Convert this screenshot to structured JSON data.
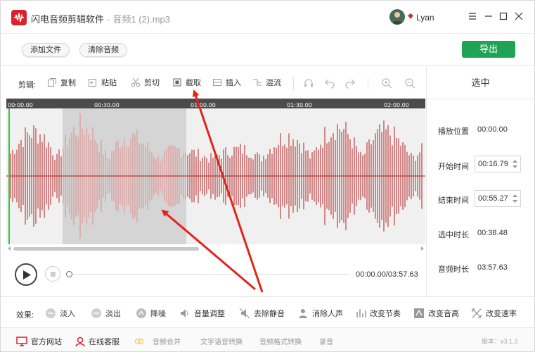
{
  "app": {
    "title": "闪电音频剪辑软件",
    "separator": "-",
    "file_name": "音频1 (2).mp3",
    "user_name": "Lyan",
    "brand_color": "#d9232d",
    "export_color": "#20a357"
  },
  "toolbar": {
    "add_file": "添加文件",
    "clear_audio": "清除音频",
    "export": "导出"
  },
  "edit": {
    "label": "剪辑:",
    "tools": [
      {
        "label": "复制",
        "icon": "copy-icon"
      },
      {
        "label": "粘贴",
        "icon": "paste-icon"
      },
      {
        "label": "剪切",
        "icon": "scissors-icon"
      },
      {
        "label": "截取",
        "icon": "crop-icon"
      },
      {
        "label": "插入",
        "icon": "insert-icon"
      },
      {
        "label": "混流",
        "icon": "mix-icon"
      }
    ]
  },
  "timeline": {
    "ticks": [
      "00:00.00",
      "00:30.00",
      "01:00.00",
      "01:30.00",
      "02:00.00"
    ]
  },
  "panel": {
    "title": "选中",
    "play_position_label": "播放位置",
    "play_position_value": "00:00.00",
    "start_label": "开始时间",
    "start_value": "00:16.79",
    "end_label": "结束时间",
    "end_value": "00:55.27",
    "selected_label": "选中时长",
    "selected_value": "00:38.48",
    "duration_label": "音频时长",
    "duration_value": "03:57.63"
  },
  "transport": {
    "timecode": "00:00.00/03:57.63",
    "progress": 0
  },
  "effects": {
    "label": "效果:",
    "items": [
      {
        "label": "淡入",
        "icon": "fade-in-icon"
      },
      {
        "label": "淡出",
        "icon": "fade-out-icon"
      },
      {
        "label": "降噪",
        "icon": "denoise-icon"
      },
      {
        "label": "音量调整",
        "icon": "volume-icon"
      },
      {
        "label": "去除静音",
        "icon": "mute-icon"
      },
      {
        "label": "消除人声",
        "icon": "vocal-remove-icon"
      },
      {
        "label": "改变节奏",
        "icon": "tempo-icon"
      },
      {
        "label": "改变音高",
        "icon": "pitch-icon"
      },
      {
        "label": "改变速率",
        "icon": "speed-icon"
      }
    ]
  },
  "bottom": {
    "website": "官方网站",
    "online_service": "在线客服",
    "audio_merge": "音频合并",
    "tts": "文字语音转换",
    "format_convert": "音频格式转换",
    "record": "录音",
    "version": "版本：v3.1.3"
  }
}
